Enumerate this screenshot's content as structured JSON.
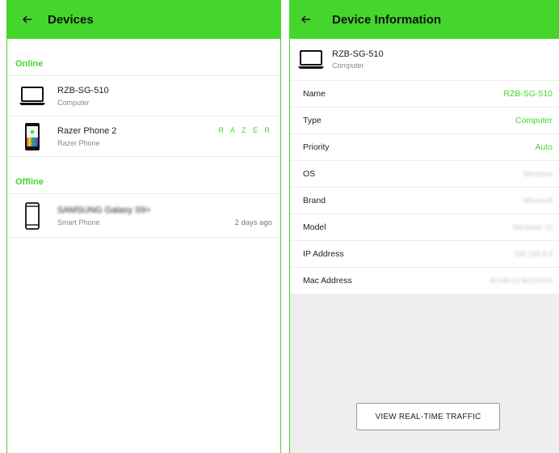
{
  "left": {
    "title": "Devices",
    "online_label": "Online",
    "offline_label": "Offline",
    "online_devices": [
      {
        "name": "RZB-SG-510",
        "type": "Computer",
        "icon": "laptop-icon"
      },
      {
        "name": "Razer Phone 2",
        "type": "Razer Phone",
        "icon": "razer-phone-icon",
        "watermark": "R A Z E R"
      }
    ],
    "offline_devices": [
      {
        "name": "SAMSUNG Galaxy S9+",
        "type": "Smart Phone",
        "icon": "smartphone-icon",
        "last_seen": "2 days ago"
      }
    ]
  },
  "right": {
    "title": "Device Information",
    "device": {
      "name": "RZB-SG-510",
      "type": "Computer"
    },
    "fields": [
      {
        "key": "Name",
        "value": "RZB-SG-510"
      },
      {
        "key": "Type",
        "value": "Computer"
      },
      {
        "key": "Priority",
        "value": "Auto"
      },
      {
        "key": "OS",
        "value": "Windows"
      },
      {
        "key": "Brand",
        "value": "Microsoft"
      },
      {
        "key": "Model",
        "value": "Windows 10"
      },
      {
        "key": "IP Address",
        "value": "192.168.8.4"
      },
      {
        "key": "Mac Address",
        "value": "40:A8:C2:B0:D0:F6"
      }
    ],
    "button_label": "VIEW REAL-TIME TRAFFIC"
  },
  "colors": {
    "accent": "#44d62c",
    "background": "#eeeeee"
  }
}
